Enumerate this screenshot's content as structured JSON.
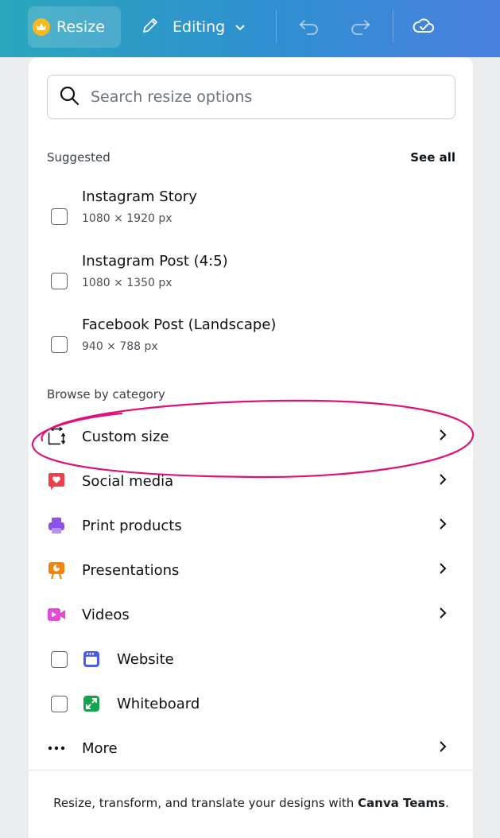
{
  "toolbar": {
    "resize_label": "Resize",
    "editing_label": "Editing"
  },
  "search": {
    "placeholder": "Search resize options",
    "value": ""
  },
  "suggested": {
    "title": "Suggested",
    "see_all": "See all",
    "items": [
      {
        "name": "Instagram Story",
        "dims": "1080 × 1920 px"
      },
      {
        "name": "Instagram Post (4:5)",
        "dims": "1080 × 1350 px"
      },
      {
        "name": "Facebook Post (Landscape)",
        "dims": "940 × 788 px"
      }
    ]
  },
  "browse": {
    "title": "Browse by category",
    "items": [
      {
        "label": "Custom size",
        "icon": "custom-size-icon"
      },
      {
        "label": "Social media",
        "icon": "heart-icon"
      },
      {
        "label": "Print products",
        "icon": "printer-icon"
      },
      {
        "label": "Presentations",
        "icon": "presentation-icon"
      },
      {
        "label": "Videos",
        "icon": "video-icon"
      },
      {
        "label": "Website",
        "icon": "website-icon"
      },
      {
        "label": "Whiteboard",
        "icon": "whiteboard-icon"
      },
      {
        "label": "More",
        "icon": "more-dots-icon"
      }
    ]
  },
  "footer": {
    "text_before": "Resize, transform, and translate your designs with ",
    "brand": "Canva Teams",
    "text_after": "."
  },
  "colors": {
    "toolbar_start": "#2aa6bd",
    "toolbar_end": "#4a80e0",
    "crown": "#f7b91b",
    "social": "#ef3d49",
    "print": "#8e50e9",
    "presentations": "#f5820d",
    "videos": "#e34ad6",
    "website": "#4b5bed",
    "whiteboard": "#14a44d",
    "annotation": "#e0107a"
  }
}
